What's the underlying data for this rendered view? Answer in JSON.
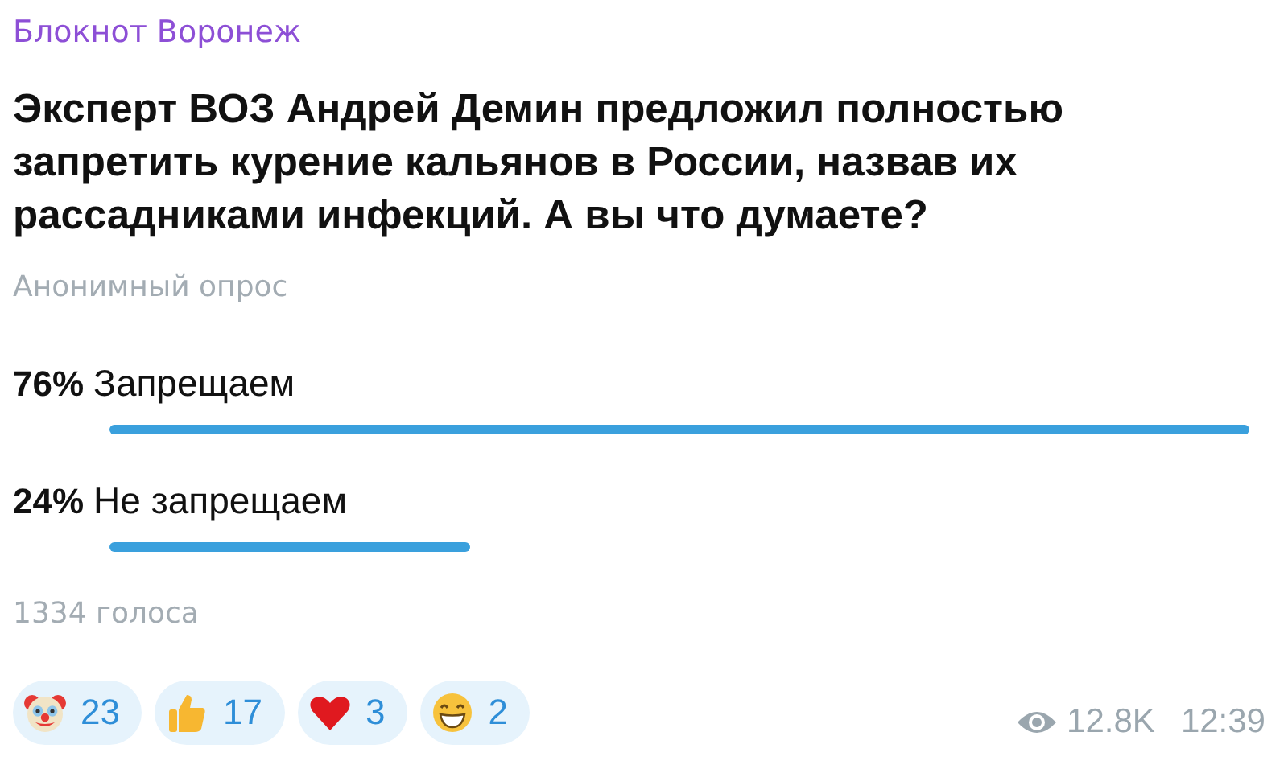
{
  "channel": {
    "name": "Блокнот Воронеж"
  },
  "poll": {
    "question": "Эксперт ВОЗ Андрей Демин предложил полностью запретить курение кальянов в России, назвав их рассадниками инфекций.  А вы что думаете?",
    "type_label": "Анонимный опрос",
    "options": [
      {
        "percent": "76%",
        "label": "Запрещаем"
      },
      {
        "percent": "24%",
        "label": "Не запрещаем"
      }
    ],
    "votes": "1334 голоса"
  },
  "reactions": [
    {
      "kind": "clown",
      "count": "23"
    },
    {
      "kind": "thumbs_up",
      "count": "17"
    },
    {
      "kind": "heart",
      "count": "3"
    },
    {
      "kind": "grin",
      "count": "2"
    }
  ],
  "views": "12.8K",
  "time": "12:39"
}
